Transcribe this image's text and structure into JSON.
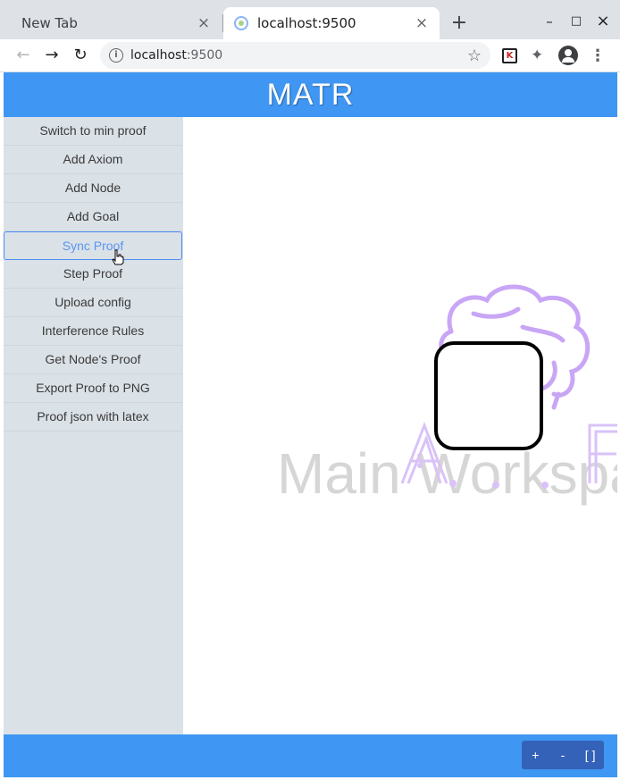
{
  "browser": {
    "tabs": [
      {
        "title": "New Tab",
        "close": "×"
      },
      {
        "title": "localhost:9500",
        "close": "×"
      }
    ],
    "new_tab": "+",
    "window_controls": {
      "minimize": "–",
      "maximize": "□",
      "close": "×"
    },
    "address": {
      "host": "localhost",
      "port": ":9500"
    },
    "icons": {
      "back": "arrow-left-icon",
      "forward": "arrow-right-icon",
      "reload": "reload-icon",
      "info": "info-icon",
      "star": "star-icon",
      "extension": "puzzle-icon",
      "profile": "avatar-icon",
      "menu": "kebab-icon"
    },
    "ext_k_label": "K"
  },
  "app": {
    "title": "MATR",
    "sidebar": {
      "items": [
        {
          "label": "Switch to min proof"
        },
        {
          "label": "Add Axiom"
        },
        {
          "label": "Add Node"
        },
        {
          "label": "Add Goal"
        },
        {
          "label": "Sync Proof",
          "active": true
        },
        {
          "label": "Step Proof"
        },
        {
          "label": "Upload config"
        },
        {
          "label": "Interference Rules"
        },
        {
          "label": "Get Node's Proof"
        },
        {
          "label": "Export Proof to PNG"
        },
        {
          "label": "Proof json with latex"
        }
      ]
    },
    "workspace": {
      "watermark": "Main Workspace"
    },
    "footer": {
      "zoom_in": "+",
      "zoom_out": "-",
      "fit": "[ ]"
    },
    "colors": {
      "header": "#3f96f3",
      "sidebar": "#dae1e7",
      "active": "#5a96f2",
      "zoom": "#3462b8",
      "brain": "#c9a6f5"
    }
  }
}
